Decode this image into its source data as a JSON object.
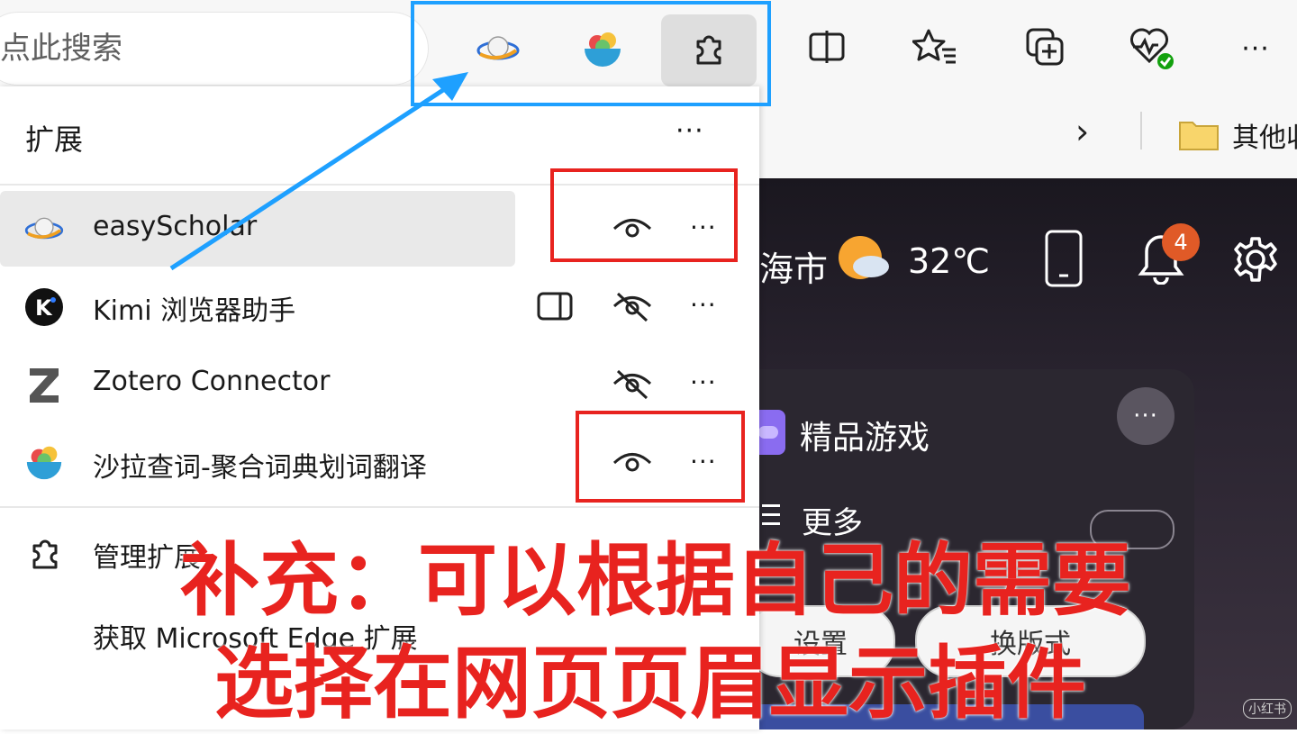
{
  "toolbar": {
    "search_placeholder": "点此搜索",
    "extension_icons": [
      "easyscholar-icon",
      "salad-icon",
      "puzzle-icon"
    ],
    "right_icons": [
      "split-screen-icon",
      "favorites-icon",
      "collections-icon",
      "browser-essentials-icon",
      "more-icon"
    ],
    "more_label": "···"
  },
  "favorites_bar": {
    "chevron": "›",
    "folder_label": "其他收"
  },
  "panel": {
    "title": "扩展",
    "more_label": "···",
    "extensions": [
      {
        "name": "easyScholar",
        "visible": true,
        "sidebar": false
      },
      {
        "name": "Kimi 浏览器助手",
        "visible": false,
        "sidebar": true
      },
      {
        "name": "Zotero Connector",
        "visible": false,
        "sidebar": false
      },
      {
        "name": "沙拉查词-聚合词典划词翻译",
        "visible": true,
        "sidebar": false
      }
    ],
    "manage_label": "管理扩展",
    "get_label": "获取 Microsoft Edge 扩展"
  },
  "newtab": {
    "city": "海市",
    "temperature": "32℃",
    "notification_count": "4",
    "games_label": "精品游戏",
    "more_label": "更多",
    "pill_1": "设置",
    "pill_2": "换版式",
    "card_more": "···",
    "watermark": "小红书"
  },
  "annotations": {
    "caption_line1": "补充：可以根据自己的需要",
    "caption_line2": "选择在网页页眉显示插件",
    "colors": {
      "red": "#e8231f",
      "blue": "#1ea0ff"
    }
  }
}
